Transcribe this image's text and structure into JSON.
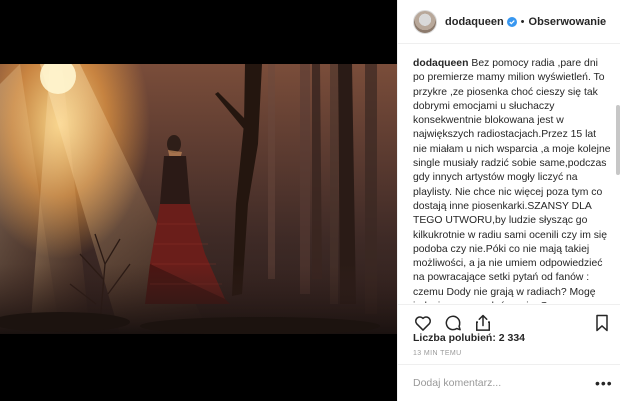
{
  "post": {
    "image_alt_icon": "photo",
    "colors": {
      "verified": "#3897f0",
      "text": "#262626",
      "muted": "#999999"
    }
  },
  "header": {
    "username": "dodaqueen",
    "separator": "•",
    "follow_label": "Obserwowanie"
  },
  "caption": {
    "username": "dodaqueen",
    "text": "Bez pomocy radia ,pare dni po premierze mamy milion wyświetleń. To przykre ,ze piosenka choć cieszy się tak dobrymi emocjami u słuchaczy konsekwentnie blokowana jest w największych radiostacjach.Przez 15 lat nie miałam u nich wsparcia ,a moje kolejne single musiały radzić sobie same,podczas gdy innych artystów mogły liczyć na playlisty. Nie chce nic więcej poza tym co dostają inne piosenkarki.SZANSY DLA TEGO UTWORU,by ludzie słysząc go kilkukrotnie w radiu sami ocenili czy im się podoba czy nie.Póki co nie mają takiej możliwości, a ja nie umiem odpowiedzieć na powracające setki pytań od fanów : czemu Dody nie grają w radiach? Mogę jedynie sama zadać swoje :Czy musze umrzeć by z głośników mogł zabrzmieć w końcu mój głos? ARTYSTA MARTWY JEST WIĘCEJ WARTY ?"
  },
  "actions": {
    "like_icon": "heart-outline",
    "comment_icon": "speech-bubble",
    "share_icon": "share-arrow",
    "save_icon": "bookmark"
  },
  "likes": {
    "label": "Liczba polubień: 2 334"
  },
  "timestamp": {
    "label": "13 MIN TEMU"
  },
  "comment": {
    "placeholder": "Dodaj komentarz...",
    "more_label": "•••"
  }
}
